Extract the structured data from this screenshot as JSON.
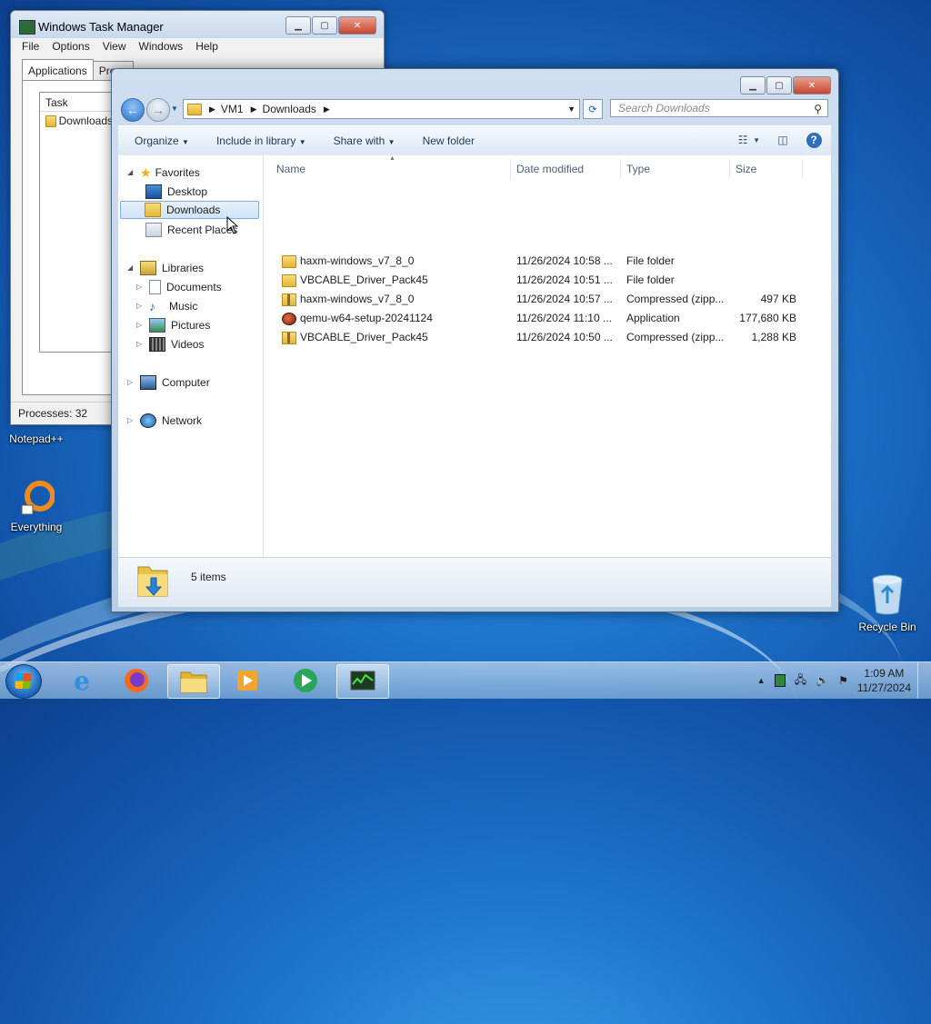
{
  "desktop": {
    "icons": [
      {
        "label": "Notepad++"
      },
      {
        "label": "Everything"
      },
      {
        "label": "Recycle Bin"
      }
    ]
  },
  "task_manager": {
    "title": "Windows Task Manager",
    "menu": [
      "File",
      "Options",
      "View",
      "Windows",
      "Help"
    ],
    "tabs": [
      "Applications",
      "Proce"
    ],
    "list_header": "Task",
    "list_items": [
      "Downloads"
    ],
    "status": "Processes: 32"
  },
  "explorer": {
    "breadcrumb": [
      "VM1",
      "Downloads"
    ],
    "search_placeholder": "Search Downloads",
    "toolbar": {
      "organize": "Organize",
      "include_in_library": "Include in library",
      "share_with": "Share with",
      "new_folder": "New folder"
    },
    "nav": {
      "favorites": "Favorites",
      "desktop": "Desktop",
      "downloads": "Downloads",
      "recent_places": "Recent Places",
      "libraries": "Libraries",
      "documents": "Documents",
      "music": "Music",
      "pictures": "Pictures",
      "videos": "Videos",
      "computer": "Computer",
      "network": "Network"
    },
    "columns": {
      "name": "Name",
      "date": "Date modified",
      "type": "Type",
      "size": "Size"
    },
    "files": [
      {
        "name": "haxm-windows_v7_8_0",
        "date": "11/26/2024 10:58 ...",
        "type": "File folder",
        "size": "",
        "icon": "folder-icon"
      },
      {
        "name": "VBCABLE_Driver_Pack45",
        "date": "11/26/2024 10:51 ...",
        "type": "File folder",
        "size": "",
        "icon": "folder-icon"
      },
      {
        "name": "haxm-windows_v7_8_0",
        "date": "11/26/2024 10:57 ...",
        "type": "Compressed (zipp...",
        "size": "497 KB",
        "icon": "zip-folder-icon"
      },
      {
        "name": "qemu-w64-setup-20241124",
        "date": "11/26/2024 11:10 ...",
        "type": "Application",
        "size": "177,680 KB",
        "icon": "application-icon"
      },
      {
        "name": "VBCABLE_Driver_Pack45",
        "date": "11/26/2024 10:50 ...",
        "type": "Compressed (zipp...",
        "size": "1,288 KB",
        "icon": "zip-folder-icon"
      }
    ],
    "details": {
      "item_count": "5 items"
    }
  },
  "taskbar": {
    "clock_time": "1:09 AM",
    "clock_date": "11/27/2024"
  }
}
